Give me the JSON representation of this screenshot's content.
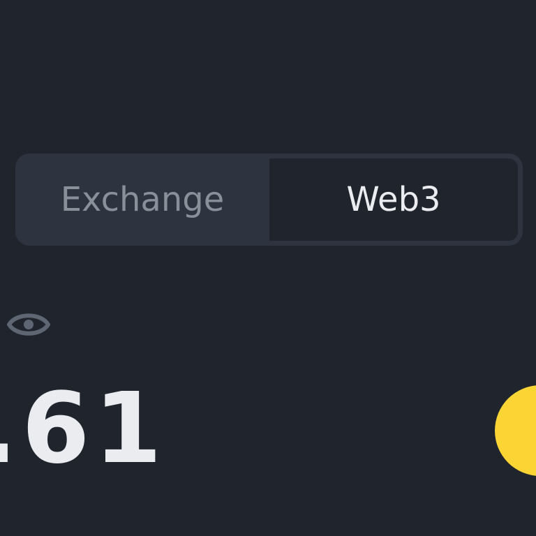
{
  "account_tabs": [
    {
      "label": "Exchange",
      "selected": false
    },
    {
      "label": "Web3",
      "selected": true
    }
  ],
  "balance": {
    "visibility_icon": "eye-icon",
    "value_fragment": ".61"
  },
  "colors": {
    "background": "#1f242d",
    "segment_track": "#2d3440",
    "selected_text": "#eaecef",
    "unselected_text": "#8a909a",
    "accent": "#fcd535"
  }
}
